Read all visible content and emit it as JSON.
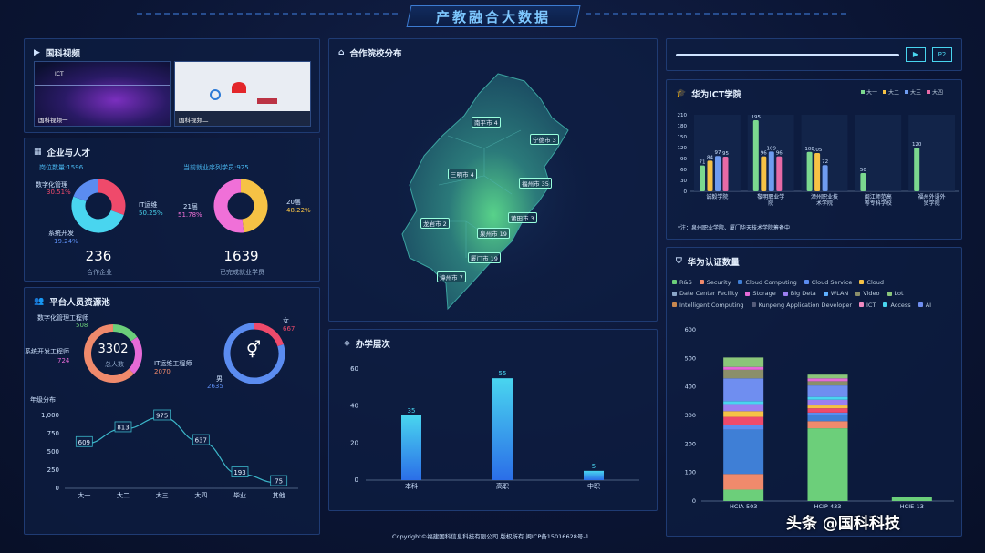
{
  "header": {
    "title": "产教融合大数据"
  },
  "video_panel": {
    "title": "国科视频",
    "video1": "国科视频一",
    "video2": "国科视频二"
  },
  "enterprise_panel": {
    "title": "企业与人才",
    "jobs_label": "岗位数量:1596",
    "employ_label": "当前就业序列学员:925",
    "donut1": {
      "segments": [
        {
          "name": "数字化管理",
          "pct": "30.51%",
          "color": "#ef4a6b",
          "value": 30.51
        },
        {
          "name": "IT运维",
          "pct": "50.25%",
          "color": "#49d5ef",
          "value": 50.25
        },
        {
          "name": "系统开发",
          "pct": "19.24%",
          "color": "#5b8cf0",
          "value": 19.24
        }
      ],
      "total": "236",
      "caption": "合作企业"
    },
    "donut2": {
      "segments": [
        {
          "name": "20届",
          "pct": "48.22%",
          "color": "#f6c245",
          "value": 48.22
        },
        {
          "name": "21届",
          "pct": "51.78%",
          "color": "#f070d8",
          "value": 51.78
        }
      ],
      "total": "1639",
      "caption": "已完成就业学员"
    }
  },
  "talent_panel": {
    "title": "平台人员资源池",
    "donut": {
      "center": "3302",
      "caption": "总人数",
      "segments": [
        {
          "name": "数字化管理工程师",
          "value": "508",
          "color": "#6ccf7a"
        },
        {
          "name": "系统开发工程师",
          "value": "724",
          "color": "#e66ad7"
        },
        {
          "name": "IT运维工程师",
          "value": "2070",
          "color": "#f08a6c"
        }
      ]
    },
    "gender": {
      "female_label": "女",
      "female": "667",
      "male_label": "男",
      "male": "2635"
    },
    "grade_title": "年级分布"
  },
  "map_panel": {
    "title": "合作院校分布",
    "cities": [
      "南平市 4",
      "宁德市 3",
      "三明市 4",
      "福州市 35",
      "莆田市 3",
      "龙岩市 2",
      "泉州市 19",
      "厦门市 19",
      "漳州市 7"
    ]
  },
  "school_panel": {
    "title": "办学层次"
  },
  "player": {
    "btn": "▶",
    "page": "P2"
  },
  "ict_panel": {
    "title": "华为ICT学院",
    "note": "*注：泉州职业学院、厦门华天技术学院筹备中"
  },
  "cert_panel": {
    "title": "华为认证数量"
  },
  "footer": {
    "copyright": "Copyright©福建国科信息科技有限公司 版权所有 闽ICP备15016628号-1",
    "watermark": "头条 @国科科技"
  },
  "chart_data": [
    {
      "id": "grade",
      "type": "line",
      "categories": [
        "大一",
        "大二",
        "大三",
        "大四",
        "毕业",
        "其他"
      ],
      "values": [
        609,
        813,
        975,
        637,
        193,
        75
      ],
      "ylim": [
        0,
        1000
      ],
      "yticks": [
        "0",
        "250",
        "500",
        "750",
        "1,000"
      ]
    },
    {
      "id": "school",
      "type": "bar",
      "categories": [
        "本科",
        "高职",
        "中职"
      ],
      "values": [
        35,
        55,
        5
      ],
      "ylim": [
        0,
        60
      ],
      "yticks": [
        "0",
        "20",
        "40",
        "60"
      ]
    },
    {
      "id": "ict",
      "type": "bar",
      "legend": [
        "大一",
        "大二",
        "大三",
        "大四"
      ],
      "colors": [
        "#7bd88f",
        "#f6c245",
        "#6f9cf0",
        "#e76aa6"
      ],
      "categories": [
        "诚毅学院",
        "黎明职业学院",
        "漳州职业技术学院",
        "闽江师范高等专科学校",
        "福州外语外贸学院"
      ],
      "series": [
        {
          "name": "大一",
          "values": [
            71,
            195,
            108,
            50,
            120
          ]
        },
        {
          "name": "大二",
          "values": [
            84,
            96,
            105,
            null,
            null
          ]
        },
        {
          "name": "大三",
          "values": [
            97,
            109,
            72,
            null,
            null
          ]
        },
        {
          "name": "大四",
          "values": [
            95,
            96,
            null,
            null,
            null
          ]
        }
      ],
      "ylim": [
        0,
        210
      ],
      "yticks": [
        "0",
        "30",
        "60",
        "90",
        "120",
        "150",
        "180",
        "210"
      ]
    },
    {
      "id": "cert",
      "type": "bar",
      "stacked": true,
      "categories": [
        "HCIA-503",
        "HCIP-433",
        "HCIE-13"
      ],
      "ylim": [
        0,
        600
      ],
      "yticks": [
        "0",
        "100",
        "200",
        "300",
        "400",
        "500",
        "600"
      ],
      "legend": [
        {
          "name": "R&S",
          "color": "#6ccf7a"
        },
        {
          "name": "Security",
          "color": "#f08a6c"
        },
        {
          "name": "Cloud Computing",
          "color": "#3f7fd6"
        },
        {
          "name": "Cloud Service",
          "color": "#5b8cf0"
        },
        {
          "name": "Cloud",
          "color": "#f6c245"
        },
        {
          "name": "Date Center Fecility",
          "color": "#8aa6c8"
        },
        {
          "name": "Storage",
          "color": "#e66ad7"
        },
        {
          "name": "Big Deta",
          "color": "#9b7ff0"
        },
        {
          "name": "WLAN",
          "color": "#5fb0ff"
        },
        {
          "name": "Video",
          "color": "#8b8f6a"
        },
        {
          "name": "Lot",
          "color": "#8bc67a"
        },
        {
          "name": "Intelligent Computing",
          "color": "#c7874f"
        },
        {
          "name": "Kunpeng Application Developer",
          "color": "#555c7a"
        },
        {
          "name": "ICT",
          "color": "#f08ac0"
        },
        {
          "name": "Access",
          "color": "#49d5ef"
        },
        {
          "name": "AI",
          "color": "#6f8ef0"
        }
      ],
      "series": [
        {
          "name": "R&S",
          "values": [
            40,
            255,
            13
          ]
        },
        {
          "name": "Security",
          "values": [
            55,
            25,
            0
          ]
        },
        {
          "name": "Cloud Computing",
          "values": [
            155,
            20,
            0
          ]
        },
        {
          "name": "Cloud Service",
          "values": [
            15,
            10,
            0
          ]
        },
        {
          "name": "Security2",
          "values": [
            30,
            15,
            0
          ]
        },
        {
          "name": "Cloud",
          "values": [
            20,
            10,
            0
          ]
        },
        {
          "name": "Big Deta",
          "values": [
            25,
            20,
            0
          ]
        },
        {
          "name": "Access",
          "values": [
            10,
            10,
            0
          ]
        },
        {
          "name": "AI",
          "values": [
            80,
            40,
            0
          ]
        },
        {
          "name": "Video",
          "values": [
            30,
            15,
            0
          ]
        },
        {
          "name": "Storage",
          "values": [
            10,
            10,
            0
          ]
        },
        {
          "name": "Lot",
          "values": [
            33,
            13,
            0
          ]
        }
      ]
    }
  ]
}
